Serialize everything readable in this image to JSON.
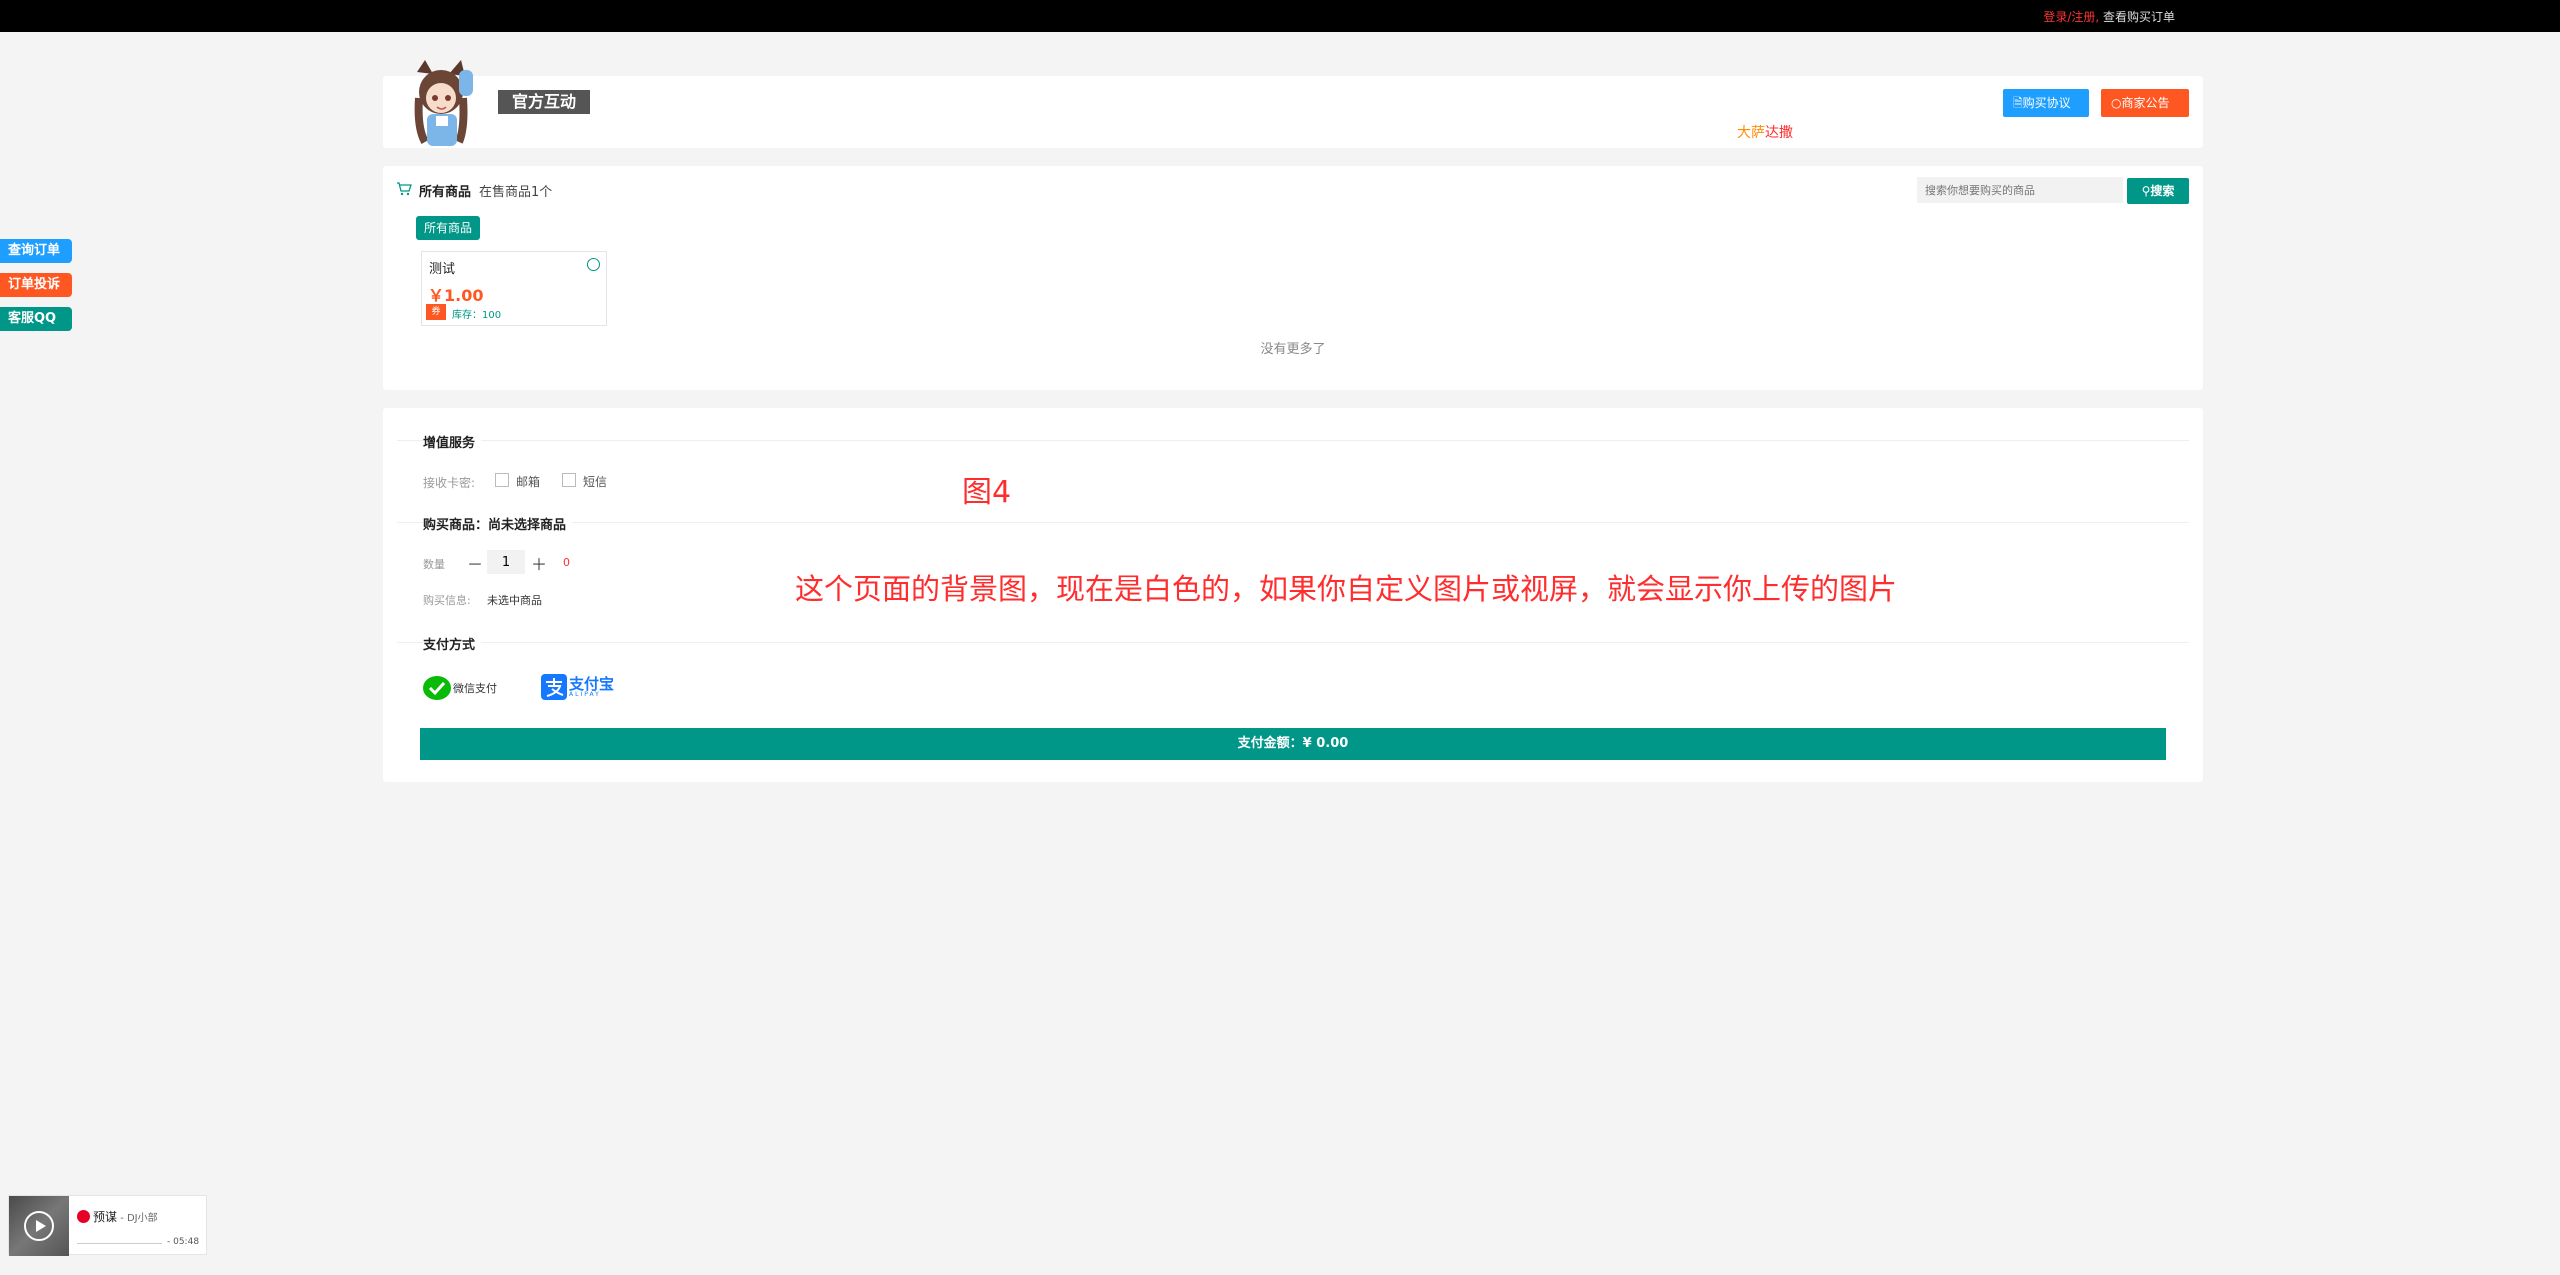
{
  "topbar": {
    "login": "登录/注册,",
    "orders": " 查看购买订单"
  },
  "header": {
    "shop_name": "官方互动",
    "marquee_a": "大萨",
    "marquee_b": "达撒",
    "agreement_btn": "购买协议",
    "notice_btn": "商家公告"
  },
  "goods": {
    "title": "所有商品",
    "count": "在售商品1个",
    "search_placeholder": "搜索你想要购买的商品",
    "search_btn": "搜索",
    "category": "所有商品",
    "items": [
      {
        "name": "测试",
        "price": "￥1.00",
        "coupon": "券",
        "stock": "库存：100"
      }
    ],
    "no_more": "没有更多了"
  },
  "order": {
    "value_added": "增值服务",
    "receive_label": "接收卡密:",
    "opt_email": "邮箱",
    "opt_sms": "短信",
    "purchase_title": "购买商品：尚未选择商品",
    "qty_label": "数量",
    "qty_minus": "－",
    "qty_value": "1",
    "qty_plus": "＋",
    "qty_stock": "0",
    "info_label": "购买信息:",
    "info_value": "未选中商品",
    "pay_title": "支付方式",
    "wechat_label": "微信支付",
    "alipay_cn": "支付宝",
    "alipay_en": "ALIPAY",
    "pay_bar": "支付金额：¥ 0.00"
  },
  "notes": {
    "figure": "图4",
    "background": "这个页面的背景图，现在是白色的，如果你自定义图片或视屏，就会显示你上传的图片"
  },
  "side": {
    "query": "查询订单",
    "complain": "订单投诉",
    "qq": "客服QQ"
  },
  "player": {
    "song": "预谋",
    "artist": " - DJ小部",
    "time": "- 05:48"
  },
  "colors": {
    "teal": "#009688",
    "blue": "#1e9fff",
    "orange": "#ff5722",
    "red": "#ff2d2d"
  }
}
